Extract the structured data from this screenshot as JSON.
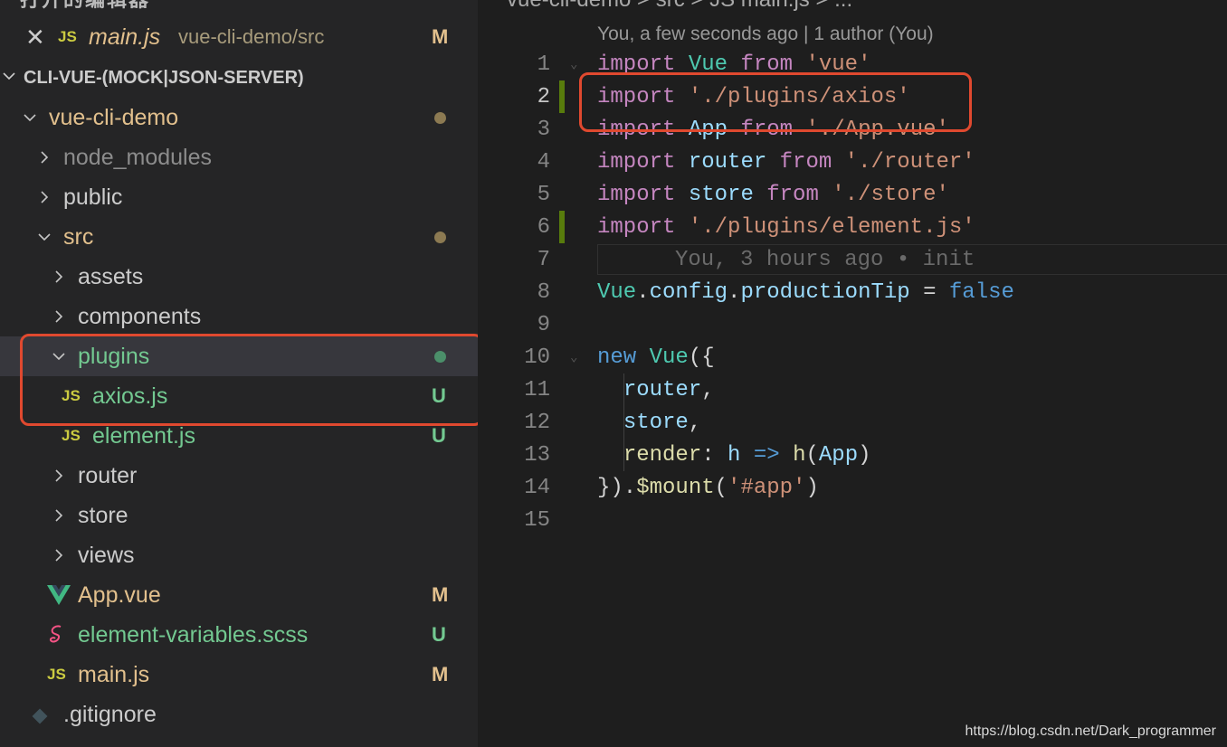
{
  "sidebar": {
    "open_editors_title": "打开的编辑器",
    "open_editor": {
      "name": "main.js",
      "path": "vue-cli-demo/src",
      "badge": "M",
      "icon": "js-icon"
    },
    "workspace_title": "CLI-VUE-(MOCK|JSON-SERVER)",
    "tree": [
      {
        "label": "vue-cli-demo",
        "type": "folder-open",
        "badge": "",
        "dot": "#8c7a52",
        "color": "#e2c08d"
      },
      {
        "label": "node_modules",
        "type": "folder",
        "badge": "",
        "color": "#8c8c8c"
      },
      {
        "label": "public",
        "type": "folder",
        "badge": "",
        "color": "#cccccc"
      },
      {
        "label": "src",
        "type": "folder-open",
        "badge": "",
        "dot": "#8c7a52",
        "color": "#e2c08d"
      },
      {
        "label": "assets",
        "type": "folder",
        "badge": "",
        "color": "#cccccc"
      },
      {
        "label": "components",
        "type": "folder",
        "badge": "",
        "color": "#cccccc"
      },
      {
        "label": "plugins",
        "type": "folder-open",
        "badge": "",
        "dot": "#4b8f6a",
        "color": "#73c991"
      },
      {
        "label": "axios.js",
        "type": "js",
        "badge": "U",
        "color": "#73c991"
      },
      {
        "label": "element.js",
        "type": "js",
        "badge": "U",
        "color": "#73c991"
      },
      {
        "label": "router",
        "type": "folder",
        "badge": "",
        "color": "#cccccc"
      },
      {
        "label": "store",
        "type": "folder",
        "badge": "",
        "color": "#cccccc"
      },
      {
        "label": "views",
        "type": "folder",
        "badge": "",
        "color": "#cccccc"
      },
      {
        "label": "App.vue",
        "type": "vue",
        "badge": "M",
        "color": "#e2c08d"
      },
      {
        "label": "element-variables.scss",
        "type": "scss",
        "badge": "U",
        "color": "#73c991"
      },
      {
        "label": "main.js",
        "type": "js",
        "badge": "M",
        "color": "#e2c08d"
      },
      {
        "label": ".gitignore",
        "type": "git",
        "badge": "",
        "color": "#cccccc"
      }
    ],
    "js_icon_text": "JS"
  },
  "editor": {
    "breadcrumb": "vue-cli-demo > src > JS main.js > ...",
    "blame_header": "You, a few seconds ago | 1 author (You)",
    "inline_blame": "You, 3 hours ago • init",
    "lines": [
      "1",
      "2",
      "3",
      "4",
      "5",
      "6",
      "7",
      "8",
      "9",
      "10",
      "11",
      "12",
      "13",
      "14",
      "15"
    ]
  },
  "watermark": "https://blog.csdn.net/Dark_programmer",
  "colors": {
    "highlight_box": "#e0492f",
    "added": "#73c991",
    "modified": "#e2c08d"
  }
}
